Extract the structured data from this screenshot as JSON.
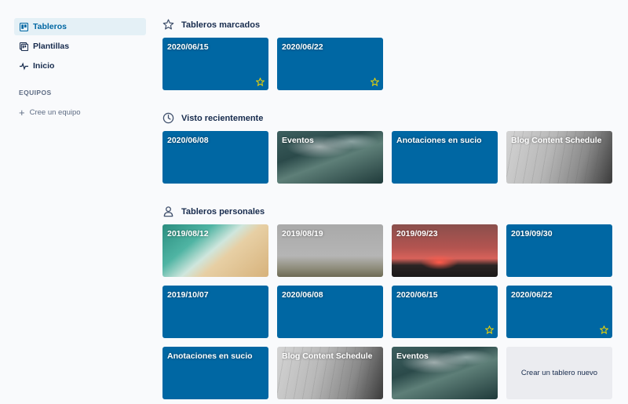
{
  "sidebar": {
    "items": [
      {
        "label": "Tableros",
        "icon": "board-icon",
        "active": true
      },
      {
        "label": "Plantillas",
        "icon": "templates-icon",
        "active": false
      },
      {
        "label": "Inicio",
        "icon": "activity-icon",
        "active": false
      }
    ],
    "teams_heading": "EQUIPOS",
    "create_team_label": "Cree un equipo"
  },
  "sections": {
    "starred": {
      "title": "Tableros marcados",
      "icon": "star-outline-icon",
      "boards": [
        {
          "title": "2020/06/15",
          "background": "blue",
          "starred": true
        },
        {
          "title": "2020/06/22",
          "background": "blue",
          "starred": true
        }
      ]
    },
    "recent": {
      "title": "Visto recientemente",
      "icon": "clock-icon",
      "boards": [
        {
          "title": "2020/06/08",
          "background": "blue",
          "starred": false
        },
        {
          "title": "Eventos",
          "background": "ocean-photo",
          "starred": false
        },
        {
          "title": "Anotaciones en sucio",
          "background": "blue",
          "starred": false
        },
        {
          "title": "Blog Content Schedule",
          "background": "notebook-photo",
          "starred": false
        }
      ]
    },
    "personal": {
      "title": "Tableros personales",
      "icon": "person-icon",
      "boards": [
        {
          "title": "2019/08/12",
          "background": "beach-photo",
          "starred": false
        },
        {
          "title": "2019/08/19",
          "background": "field-photo",
          "starred": false
        },
        {
          "title": "2019/09/23",
          "background": "sunset-photo",
          "starred": false
        },
        {
          "title": "2019/09/30",
          "background": "blue",
          "starred": false
        },
        {
          "title": "2019/10/07",
          "background": "blue",
          "starred": false
        },
        {
          "title": "2020/06/08",
          "background": "blue",
          "starred": false
        },
        {
          "title": "2020/06/15",
          "background": "blue",
          "starred": true
        },
        {
          "title": "2020/06/22",
          "background": "blue",
          "starred": true
        },
        {
          "title": "Anotaciones en sucio",
          "background": "blue",
          "starred": false
        },
        {
          "title": "Blog Content Schedule",
          "background": "notebook-photo",
          "starred": false
        },
        {
          "title": "Eventos",
          "background": "ocean-photo",
          "starred": false
        }
      ],
      "create_board_label": "Crear un tablero nuevo"
    }
  },
  "colors": {
    "board_blue": "#0067a3",
    "active_nav_bg": "#e4f0f6",
    "star_yellow": "#f2d600"
  }
}
